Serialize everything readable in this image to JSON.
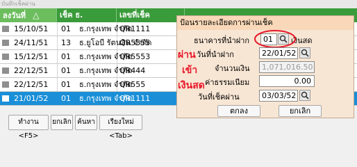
{
  "window": {
    "title": "บันทึกเช็คผ่าน"
  },
  "grid": {
    "headers": [
      "ลงวันที่",
      "เช็ค ธ.",
      "เลขที่เช็ค"
    ],
    "sort_indicator": "△",
    "rows": [
      {
        "date": "15/10/51",
        "code": "01",
        "bank": "ธ.กรุงเทพ จำกัด",
        "no": "QR1111"
      },
      {
        "date": "24/11/51",
        "code": "13",
        "bank": "ธ.ยูโอบี รัตนสิน จำกัด",
        "no": "QR5555"
      },
      {
        "date": "15/12/51",
        "code": "01",
        "bank": "ธ.กรุงเทพ จำกัด",
        "no": "QR5553"
      },
      {
        "date": "22/12/51",
        "code": "01",
        "bank": "ธ.กรุงเทพ จำกัด",
        "no": "QR444"
      },
      {
        "date": "22/12/51",
        "code": "01",
        "bank": "ธ.กรุงเทพ จำกัด",
        "no": "QR555"
      },
      {
        "date": "21/01/52",
        "code": "01",
        "bank": "ธ.กรุงเทพ จำกัด",
        "no": "QR1111"
      }
    ],
    "selected_index": 5
  },
  "toolbar": {
    "buttons": [
      "ทำงาน <F5>",
      "ยกเลิก",
      "ค้นหา",
      "เรียงใหม่ <Tab>"
    ]
  },
  "dialog": {
    "title": "ป้อนรายละเอียดการผ่านเช็ค",
    "bank_label": "ธนาคารที่นำฝาก",
    "bank_code": "01",
    "bank_suffix": "เงินสด",
    "deposit_date_label": "วันที่นำฝาก",
    "deposit_date": "22/01/52",
    "amount_label": "จำนวนเงิน",
    "amount": "1,071,016.50",
    "fee_label": "ค่าธรรมเนียม",
    "fee": "0.00",
    "pass_date_label": "วันที่เช็คผ่าน",
    "pass_date": "03/03/52",
    "ok_label": "ตกลง",
    "cancel_label": "ยกเลิก"
  },
  "annotation": {
    "lines": [
      "ผ่าน",
      "เข้า",
      "เงินสด"
    ],
    "color": "#e8182a"
  }
}
